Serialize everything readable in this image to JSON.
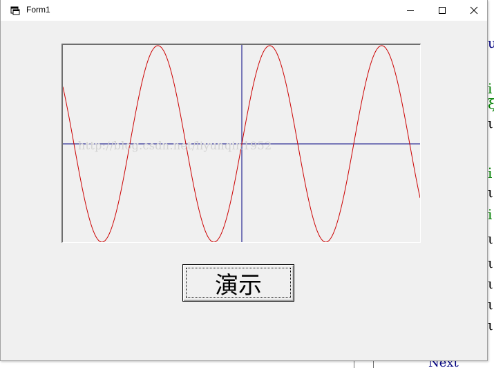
{
  "window": {
    "title": "Form1"
  },
  "picture": {
    "watermark": "http://blog.csdn.net/liyunqin1952",
    "axis_color": "#000080",
    "curve_color": "#cc0000"
  },
  "button": {
    "label": "演示"
  },
  "background": {
    "peek_chars": [
      {
        "ch": "u",
        "color": "#000080"
      },
      {
        "ch": "i",
        "color": "#008000"
      },
      {
        "ch": "ξ",
        "color": "#008000"
      },
      {
        "ch": "ι",
        "color": "#000000"
      },
      {
        "ch": "i",
        "color": "#008000"
      },
      {
        "ch": "ι",
        "color": "#000000"
      },
      {
        "ch": "i",
        "color": "#008000"
      },
      {
        "ch": "ι",
        "color": "#000000"
      },
      {
        "ch": "ι",
        "color": "#000000"
      },
      {
        "ch": "ι",
        "color": "#000000"
      },
      {
        "ch": "ι",
        "color": "#000000"
      },
      {
        "ch": "ι",
        "color": "#000000"
      }
    ],
    "next_text": "Next"
  }
}
